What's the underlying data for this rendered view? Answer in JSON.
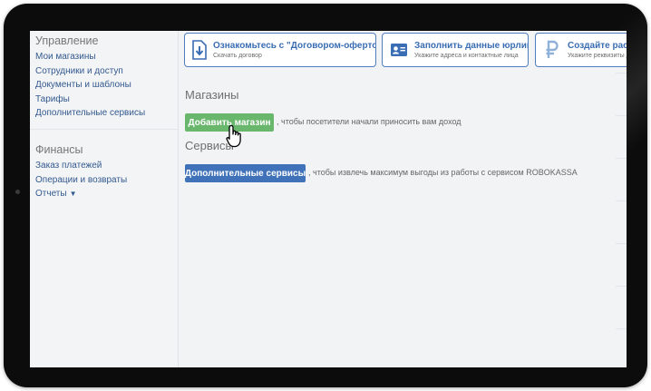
{
  "sidebar": {
    "management": {
      "title": "Управление",
      "links": [
        "Мои магазины",
        "Сотрудники и доступ",
        "Документы и шаблоны",
        "Тарифы",
        "Дополнительные сервисы"
      ]
    },
    "finance": {
      "title": "Финансы",
      "links": [
        "Заказ платежей",
        "Операции и возвраты"
      ],
      "reports_label": "Отчеты",
      "reports_arrow": "▼"
    }
  },
  "cards": [
    {
      "title": "Ознакомьтесь с \"Договором-офертой\"",
      "subtitle": "Скачать договор",
      "icon": "download-document-icon"
    },
    {
      "title": "Заполнить данные юрлица",
      "subtitle": "Укажите адреса и контактные лица",
      "icon": "id-card-icon"
    },
    {
      "title": "Создайте расч",
      "subtitle": "Укажите реквизиты д",
      "icon": "ruble-icon"
    }
  ],
  "shops": {
    "heading": "Магазины",
    "button_label": "Добавить магазин",
    "hint": ", чтобы посетители начали приносить вам доход"
  },
  "services": {
    "heading": "Сервисы",
    "button_label": "Дополнительные сервисы",
    "hint": ", чтобы извлечь максимум выгоды из работы с сервисом ROBOKASSA"
  },
  "colors": {
    "accent": "#3f72b8",
    "green": "#69b66d",
    "link": "#33598e",
    "background": "#f2f3f5"
  }
}
